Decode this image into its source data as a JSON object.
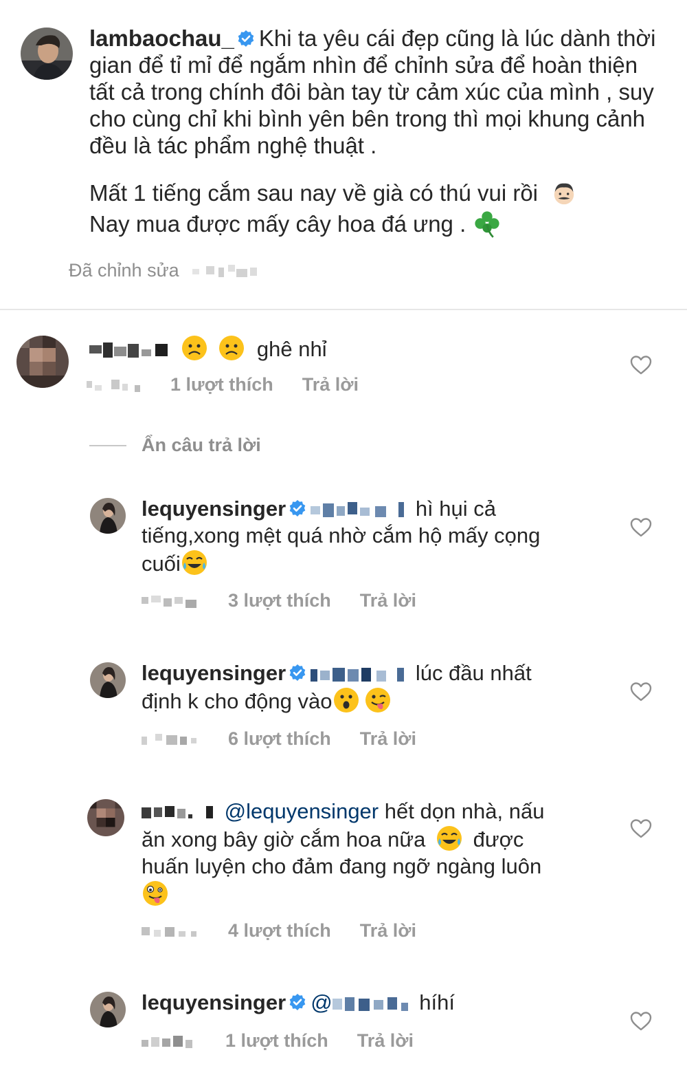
{
  "post": {
    "username": "lambaochau_",
    "caption_1": "Khi ta yêu cái đẹp cũng là lúc dành thời gian để tỉ mỉ để ngắm nhìn để chỉnh sửa để hoàn thiện tất cả trong chính đôi bàn tay từ cảm xúc của mình , suy cho cùng chỉ khi bình yên bên trong thì mọi khung cảnh đều là tác phẩm nghệ thuật .",
    "caption_2_line1": "Mất 1 tiếng cắm sau nay về già có thú vui rồi",
    "caption_2_line2": "Nay mua được mấy cây hoa đá ưng .",
    "edited_label": "Đã chỉnh sửa"
  },
  "hide_replies_label": "Ẩn câu trả lời",
  "comments": [
    {
      "text": "ghê nhỉ",
      "likes": "1 lượt thích",
      "reply": "Trả lời"
    },
    {
      "username": "lequyensinger",
      "text_a": "hì hụi cả",
      "text_b": "tiếng,xong mệt quá nhờ cắm hộ mấy cọng",
      "text_c": "cuối",
      "likes": "3 lượt thích",
      "reply": "Trả lời"
    },
    {
      "username": "lequyensinger",
      "text_a": "lúc đầu nhất",
      "text_b": "định k cho động vào",
      "likes": "6 lượt thích",
      "reply": "Trả lời"
    },
    {
      "mention": "@lequyensinger",
      "text_a": "hết dọn nhà, nấu",
      "text_b": "ăn xong bây giờ cắm hoa nữa",
      "text_c": "được",
      "text_d": "huấn luyện cho đảm đang ngỡ ngàng luôn",
      "likes": "4 lượt thích",
      "reply": "Trả lời"
    },
    {
      "username": "lequyensinger",
      "mention_prefix": "@",
      "text_a": "híhí",
      "likes": "1 lượt thích",
      "reply": "Trả lời"
    }
  ],
  "colors": {
    "verified": "#3897f0",
    "mention": "#00376b",
    "muted": "#8e8e8e"
  },
  "icons": {
    "verified": "verified-badge-icon",
    "heart": "heart-outline-icon"
  }
}
